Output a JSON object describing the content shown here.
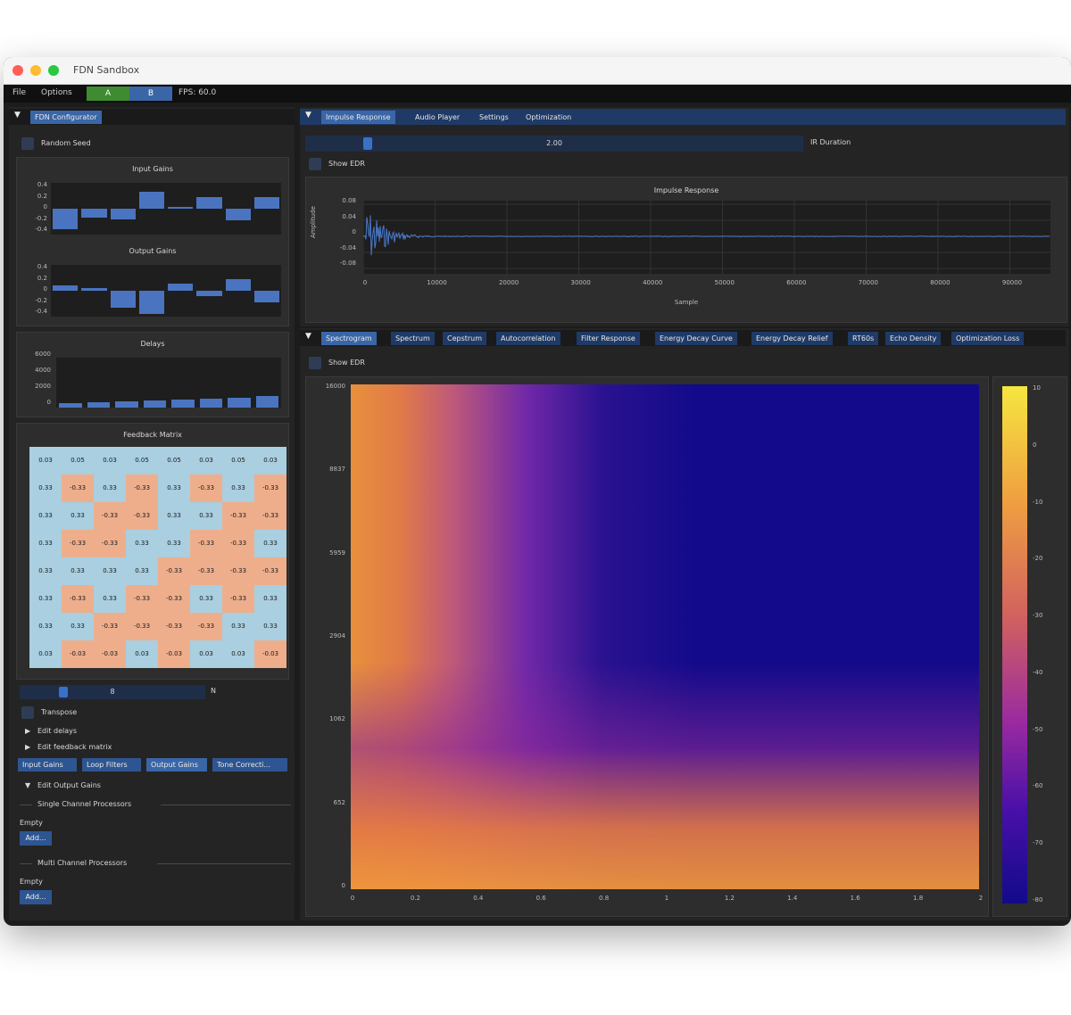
{
  "window": {
    "title": "FDN Sandbox"
  },
  "menubar": {
    "file": "File",
    "options": "Options",
    "btn_green": "A",
    "btn_blue": "B",
    "fps": "FPS: 60.0"
  },
  "left": {
    "tab": "FDN Configurator",
    "random_seed": "Random Seed",
    "input_gains": {
      "title": "Input Gains",
      "ticks": [
        "0.4",
        "0.2",
        "0",
        "-0.2",
        "-0.4"
      ],
      "values": [
        -0.35,
        -0.15,
        -0.18,
        0.3,
        0.0,
        0.2,
        -0.2,
        0.2
      ]
    },
    "output_gains": {
      "title": "Output Gains",
      "ticks": [
        "0.4",
        "0.2",
        "0",
        "-0.2",
        "-0.4"
      ],
      "values": [
        0.1,
        0.05,
        -0.3,
        -0.4,
        0.12,
        -0.1,
        0.2,
        -0.2
      ]
    },
    "delays": {
      "title": "Delays",
      "ticks": [
        "6000",
        "4000",
        "2000",
        "0"
      ],
      "values": [
        500,
        650,
        800,
        900,
        1000,
        1100,
        1200,
        1400
      ]
    },
    "feedback": {
      "title": "Feedback Matrix",
      "rows": [
        [
          "0.03",
          "0.05",
          "0.03",
          "0.05",
          "0.05",
          "0.03",
          "0.05",
          "0.03"
        ],
        [
          "0.33",
          "-0.33",
          "0.33",
          "-0.33",
          "0.33",
          "-0.33",
          "0.33",
          "-0.33"
        ],
        [
          "0.33",
          "0.33",
          "-0.33",
          "-0.33",
          "0.33",
          "0.33",
          "-0.33",
          "-0.33"
        ],
        [
          "0.33",
          "-0.33",
          "-0.33",
          "0.33",
          "0.33",
          "-0.33",
          "-0.33",
          "0.33"
        ],
        [
          "0.33",
          "0.33",
          "0.33",
          "0.33",
          "-0.33",
          "-0.33",
          "-0.33",
          "-0.33"
        ],
        [
          "0.33",
          "-0.33",
          "0.33",
          "-0.33",
          "-0.33",
          "0.33",
          "-0.33",
          "0.33"
        ],
        [
          "0.33",
          "0.33",
          "-0.33",
          "-0.33",
          "-0.33",
          "-0.33",
          "0.33",
          "0.33"
        ],
        [
          "0.03",
          "-0.03",
          "-0.03",
          "0.03",
          "-0.03",
          "0.03",
          "0.03",
          "-0.03"
        ]
      ]
    },
    "n_slider": {
      "value": "8",
      "label": "N",
      "fraction": 0.2
    },
    "transpose": "Transpose",
    "edit_delays": "Edit delays",
    "edit_feedback": "Edit feedback matrix",
    "subtabs": [
      "Input Gains",
      "Loop Filters",
      "Output Gains",
      "Tone Correcti..."
    ],
    "edit_output": "Edit Output Gains",
    "single_header": "Single Channel Processors",
    "empty1": "Empty",
    "add1": "Add...",
    "multi_header": "Multi Channel Processors",
    "empty2": "Empty",
    "add2": "Add..."
  },
  "top": {
    "tabs": [
      "Impulse Response",
      "Audio Player",
      "Settings",
      "Optimization"
    ],
    "ir_duration": {
      "value": "2.00",
      "label": "IR Duration",
      "fraction": 0.11
    },
    "show_edr": "Show EDR",
    "ir_plot": {
      "title": "Impulse Response",
      "ylabel": "Amplitude",
      "xlabel": "Sample",
      "yticks": [
        "0.08",
        "0.04",
        "0",
        "-0.04",
        "-0.08"
      ],
      "xticks": [
        "0",
        "10000",
        "20000",
        "30000",
        "40000",
        "50000",
        "60000",
        "70000",
        "80000",
        "90000"
      ]
    }
  },
  "bottom": {
    "tabs": [
      "Spectrogram",
      "Spectrum",
      "Cepstrum",
      "Autocorrelation",
      "Filter Response",
      "Energy Decay Curve",
      "Energy Decay Relief",
      "RT60s",
      "Echo Density",
      "Optimization Loss"
    ],
    "show_edr": "Show EDR",
    "spectrogram": {
      "yticks": [
        "16000",
        "8837",
        "5959",
        "2904",
        "1062",
        "652",
        "0"
      ],
      "xticks": [
        "0",
        "0.2",
        "0.4",
        "0.6",
        "0.8",
        "1",
        "1.2",
        "1.4",
        "1.6",
        "1.8",
        "2"
      ],
      "cbar_ticks": [
        "10",
        "0",
        "-10",
        "-20",
        "-30",
        "-40",
        "-50",
        "-60",
        "-70",
        "-80"
      ]
    }
  },
  "colors": {
    "accent": "#3a66a8",
    "tab_bar": "#1f3a66",
    "cell_blue": "#a9cfe0",
    "cell_orange": "#eeae8c",
    "green_btn": "#3e8b32"
  },
  "icons": [
    "collapse-triangle-icon",
    "tree-arrow-icon",
    "close-dot-icon",
    "minimize-dot-icon",
    "zoom-dot-icon"
  ]
}
